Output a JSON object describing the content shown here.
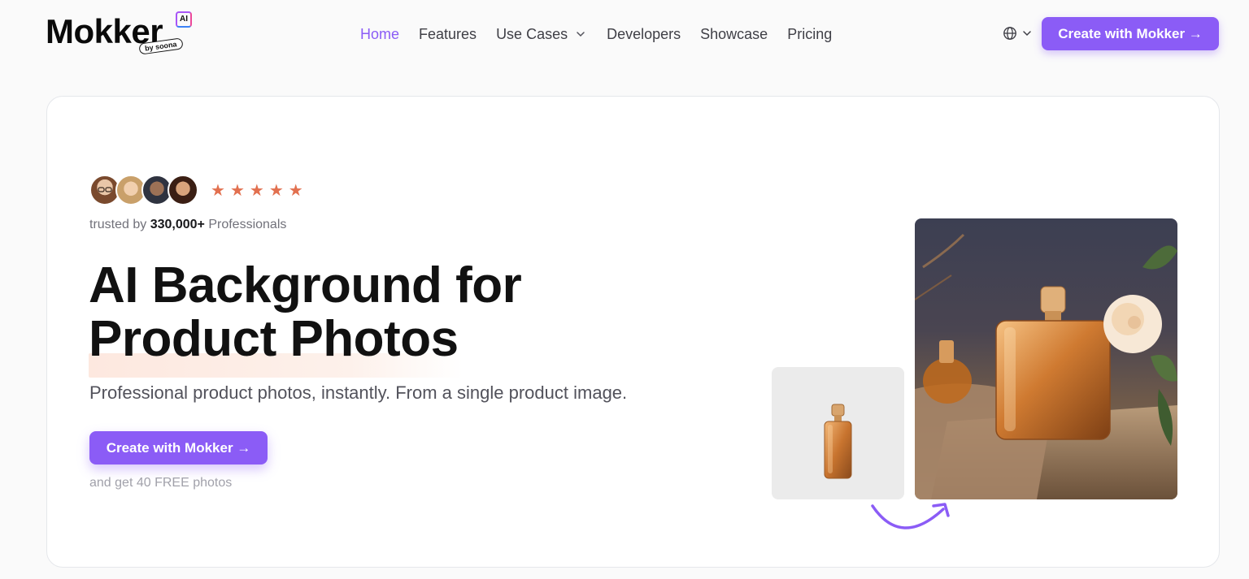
{
  "header": {
    "logo": {
      "word": "Mokker",
      "ai_badge": "AI",
      "sub": "by soona"
    },
    "nav": [
      {
        "label": "Home",
        "active": true,
        "has_dropdown": false
      },
      {
        "label": "Features",
        "active": false,
        "has_dropdown": false
      },
      {
        "label": "Use Cases",
        "active": false,
        "has_dropdown": true
      },
      {
        "label": "Developers",
        "active": false,
        "has_dropdown": false
      },
      {
        "label": "Showcase",
        "active": false,
        "has_dropdown": false
      },
      {
        "label": "Pricing",
        "active": false,
        "has_dropdown": false
      }
    ],
    "language_icon": "globe-icon",
    "cta_label": "Create with Mokker →"
  },
  "hero": {
    "rating": {
      "stars": 5,
      "max": 5
    },
    "trusted_prefix": "trusted by ",
    "trusted_count": "330,000+",
    "trusted_suffix": " Professionals",
    "headline_line1": "AI Background for",
    "headline_line2": "Product Photos",
    "subheadline": "Professional product photos, instantly. From a single product image.",
    "cta_label": "Create with Mokker →",
    "cta_note": "and get 40 FREE photos"
  },
  "colors": {
    "accent": "#8b5cf6",
    "star": "#e2704f",
    "highlight": "#fde8df"
  }
}
